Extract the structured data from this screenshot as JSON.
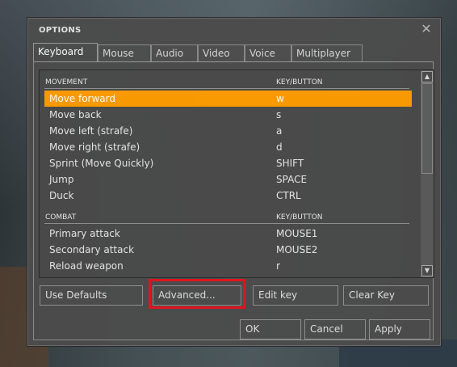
{
  "dialog": {
    "title": "OPTIONS"
  },
  "tabs": [
    {
      "label": "Keyboard",
      "active": true
    },
    {
      "label": "Mouse"
    },
    {
      "label": "Audio"
    },
    {
      "label": "Video"
    },
    {
      "label": "Voice"
    },
    {
      "label": "Multiplayer"
    }
  ],
  "list": {
    "sections": [
      {
        "name": "MOVEMENT",
        "key_header": "KEY/BUTTON",
        "rows": [
          {
            "action": "Move forward",
            "key": "w",
            "selected": true
          },
          {
            "action": "Move back",
            "key": "s"
          },
          {
            "action": "Move left (strafe)",
            "key": "a"
          },
          {
            "action": "Move right (strafe)",
            "key": "d"
          },
          {
            "action": "Sprint (Move Quickly)",
            "key": "SHIFT"
          },
          {
            "action": "Jump",
            "key": "SPACE"
          },
          {
            "action": "Duck",
            "key": "CTRL"
          }
        ]
      },
      {
        "name": "COMBAT",
        "key_header": "KEY/BUTTON",
        "rows": [
          {
            "action": "Primary attack",
            "key": "MOUSE1"
          },
          {
            "action": "Secondary attack",
            "key": "MOUSE2"
          },
          {
            "action": "Reload weapon",
            "key": "r"
          }
        ]
      }
    ]
  },
  "buttons": {
    "use_defaults": "Use Defaults",
    "advanced": "Advanced...",
    "edit_key": "Edit key",
    "clear_key": "Clear Key",
    "ok": "OK",
    "cancel": "Cancel",
    "apply": "Apply"
  },
  "colors": {
    "selection": "#ff9c00",
    "highlight_box": "#e0141e"
  },
  "icons": {
    "close": "close-icon",
    "scroll_up": "scroll-up-arrow-icon",
    "scroll_down": "scroll-down-arrow-icon"
  }
}
